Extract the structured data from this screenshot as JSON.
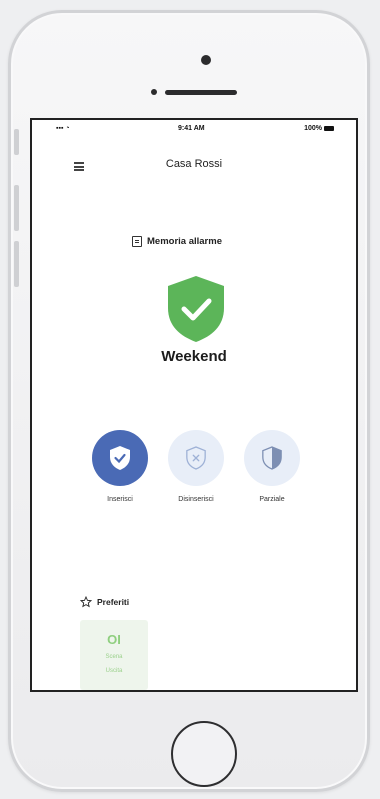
{
  "status_bar": {
    "signal": "▪▪▪ ◔",
    "time": "9:41 AM",
    "battery": "100%"
  },
  "header": {
    "title": "Casa Rossi"
  },
  "memory": {
    "label": "Memoria allarme"
  },
  "mode": {
    "name": "Weekend",
    "color": "#5cb559"
  },
  "actions": [
    {
      "label": "Inserisci",
      "icon": "shield-check-icon",
      "color": "#4a6ab5"
    },
    {
      "label": "Disinserisci",
      "icon": "shield-x-icon",
      "color": "#e8eef8"
    },
    {
      "label": "Parziale",
      "icon": "shield-half-icon",
      "color": "#e8eef8"
    }
  ],
  "favorites": {
    "label": "Preferiti",
    "card": {
      "icon_text": "OI",
      "label_line1": "Scena",
      "label_line2": "Uscita"
    }
  }
}
